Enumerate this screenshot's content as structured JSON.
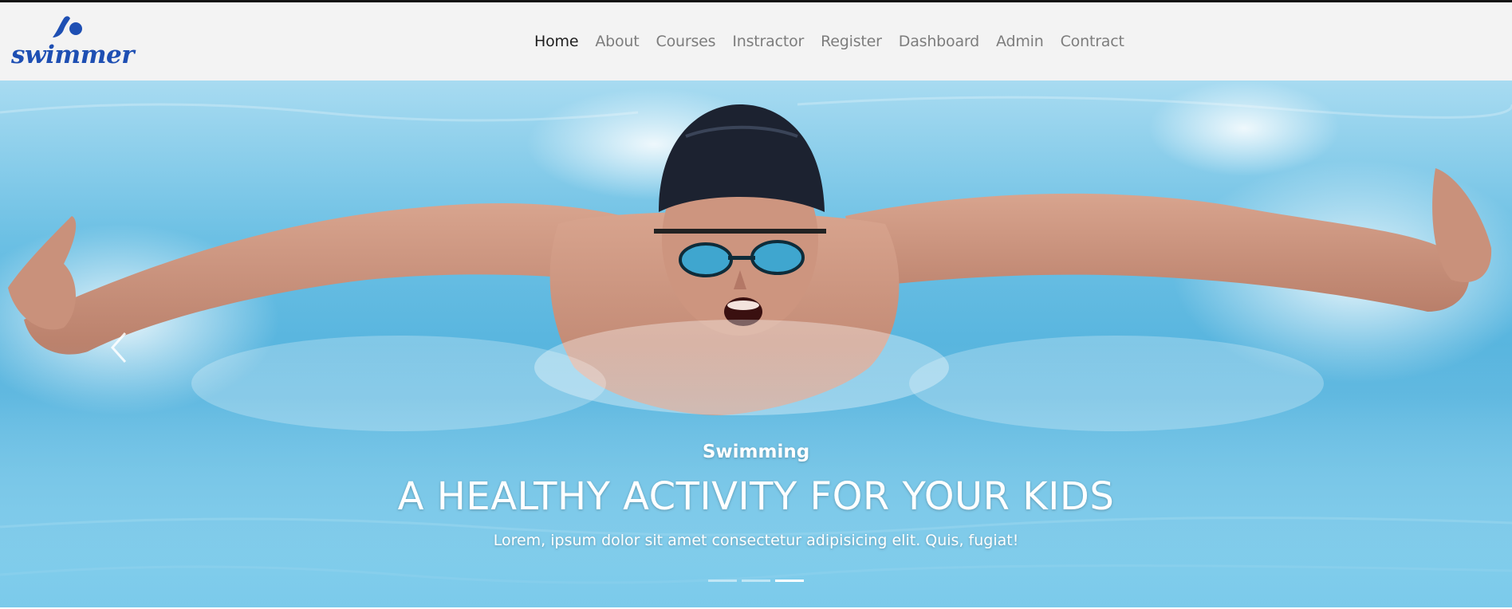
{
  "brand": {
    "name": "swimmer",
    "accent_color": "#1e4fb3",
    "icon": "swimmer-logo-icon"
  },
  "nav": {
    "items": [
      {
        "label": "Home",
        "active": true
      },
      {
        "label": "About"
      },
      {
        "label": "Courses"
      },
      {
        "label": "Instractor"
      },
      {
        "label": "Register"
      },
      {
        "label": "Dashboard"
      },
      {
        "label": "Admin"
      },
      {
        "label": "Contract"
      }
    ]
  },
  "hero": {
    "subtitle": "Swimming",
    "title": "A HEALTHY ACTIVITY FOR YOUR KIDS",
    "text": "Lorem, ipsum dolor sit amet consectetur adipisicing elit. Quis, fugiat!",
    "prev_icon": "chevron-left-icon",
    "indicators": [
      {
        "active": false
      },
      {
        "active": false
      },
      {
        "active": true
      }
    ]
  }
}
